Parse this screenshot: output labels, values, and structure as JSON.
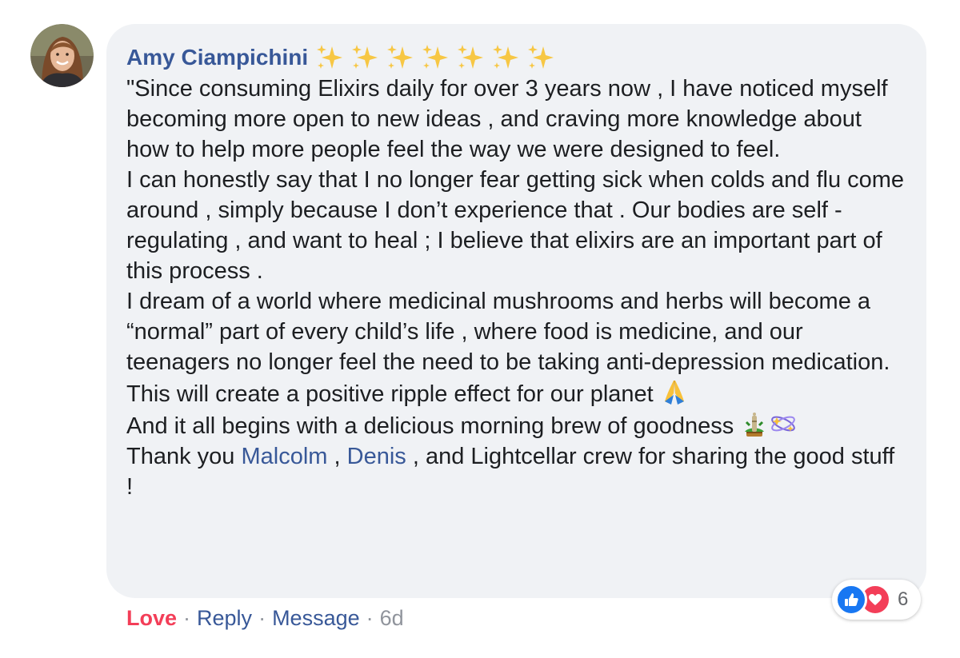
{
  "comment": {
    "author": "Amy Ciampichini",
    "author_emoji_count": 7,
    "paragraphs": {
      "p1": "\"Since consuming Elixirs daily for over 3 years now , I have noticed myself becoming more open to new ideas , and craving more knowledge about how to help more people feel the way we were designed to feel.",
      "p2": "I can honestly say that I no longer fear getting sick when colds and flu come around , simply because I don’t experience that . Our bodies are self - regulating , and want to heal ; I believe that elixirs are an important part of this process .",
      "p3": "I dream of a world where medicinal mushrooms and herbs will become a “normal” part of every child’s life , where food is medicine, and our teenagers no longer feel the need to be taking anti-depression medication. This will create a positive ripple effect for our planet",
      "p4": "And it all begins with a delicious morning brew of goodness",
      "p5_start": "Thank you",
      "p5_mention1": "Malcolm",
      "p5_sep": ",",
      "p5_mention2": "Denis",
      "p5_end": ", and Lightcellar crew for sharing the good stuff !"
    },
    "icons": {
      "author_badge": "sparkles-icon",
      "p3_end": "folded-hands-icon",
      "p4_end_1": "bamboo-decoration-icon",
      "p4_end_2": "dizzy-orbit-icon"
    }
  },
  "actions": {
    "love": "Love",
    "reply": "Reply",
    "message": "Message",
    "time": "6d",
    "separator": "·"
  },
  "reactions": {
    "count": "6",
    "types": [
      "like",
      "love"
    ],
    "like_color": "#1877f2",
    "love_color": "#f33e58"
  },
  "colors": {
    "bubble_bg": "#f0f2f5",
    "link": "#385898",
    "text": "#1c1e21",
    "love": "#f33e58",
    "meta": "#90949c"
  }
}
